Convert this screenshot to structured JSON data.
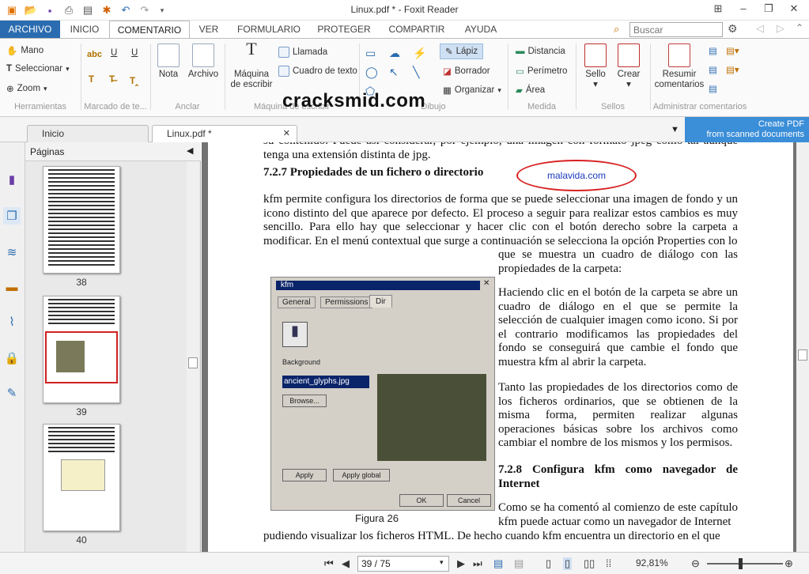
{
  "app": {
    "title": "Linux.pdf * - Foxit Reader"
  },
  "menu": {
    "tabs": [
      {
        "label": "ARCHIVO"
      },
      {
        "label": "INICIO"
      },
      {
        "label": "COMENTARIO"
      },
      {
        "label": "VER"
      },
      {
        "label": "FORMULARIO"
      },
      {
        "label": "PROTEGER"
      },
      {
        "label": "COMPARTIR"
      },
      {
        "label": "AYUDA"
      }
    ],
    "active": "COMENTARIO"
  },
  "search": {
    "placeholder": "Buscar"
  },
  "ribbon": {
    "tools": {
      "mano": "Mano",
      "seleccionar": "Seleccionar",
      "zoom": "Zoom"
    },
    "anclar": {
      "nota": "Nota",
      "archivo": "Archivo"
    },
    "maquina": {
      "label": "Máquina de escribir",
      "llamada": "Llamada",
      "cuadro": "Cuadro de texto"
    },
    "drawing": {
      "lapiz": "Lápiz",
      "borrador": "Borrador",
      "organizar": "Organizar"
    },
    "medida": {
      "distancia": "Distancia",
      "perimetro": "Perímetro",
      "area": "Área"
    },
    "sellos": {
      "sello": "Sello",
      "crear": "Crear"
    },
    "admin": {
      "resumir": "Resumir comentarios"
    },
    "groups": [
      "Herramientas",
      "Marcado de te...",
      "Anclar",
      "Máquina de escribir",
      "Dibujo",
      "Medida",
      "Sellos",
      "Administrar comentarios"
    ],
    "watermark": "cracksmid.com"
  },
  "doctabs": [
    {
      "label": "Inicio"
    },
    {
      "label": "Linux.pdf *"
    }
  ],
  "ad": {
    "line1": "Create PDF",
    "line2": "from scanned documents"
  },
  "panel": {
    "title": "Páginas",
    "pages": [
      "38",
      "39",
      "40"
    ]
  },
  "document": {
    "top": "su contenido. Puede así considerar, por ejemplo, una imagen con formato jpeg como tal aunque tenga una extensión distinta de jpg.",
    "heading1": "7.2.7  Propiedades de un fichero o directorio",
    "stamp": "malavida.com",
    "p1": "kfm permite configura los directorios de forma que se puede seleccionar una imagen de fondo y un icono distinto del que aparece por defecto. El proceso a seguir para realizar estos cambios es muy sencillo. Para ello hay que seleccionar y hacer clic con el botón derecho sobre la carpeta a modificar. En el menú contextual que surge a continuación se selecciona la opción Properties con lo",
    "p1b": "que se muestra un cuadro de diálogo con las propiedades de la carpeta:",
    "p2": "Haciendo clic en el botón de la carpeta se abre un cuadro de diálogo en el que se permite la selección de cualquier imagen como icono. Si por el contrario modificamos las propiedades del fondo se conseguirá que cambie el fondo que muestra kfm al abrir la carpeta.",
    "p3": "Tanto las propiedades de los directorios como de los ficheros ordinarios, que se obtienen de la misma forma, permiten realizar algunas operaciones básicas sobre los archivos como cambiar el nombre de los mismos y los permisos.",
    "heading2": "7.2.8  Configura kfm como navegador de Internet",
    "p4": "Como se ha comentó al comienzo de este capítulo kfm puede actuar como un navegador de Internet",
    "p5": "pudiendo visualizar los ficheros HTML. De hecho cuando kfm encuentra un directorio en el que",
    "caption": "Figura 26"
  },
  "dialog": {
    "title": "kfm",
    "tabs": [
      "General",
      "Permissions",
      "Dir"
    ],
    "background": "Background",
    "file": "ancient_glyphs.jpg",
    "browse": "Browse...",
    "apply": "Apply",
    "apply_global": "Apply global",
    "ok": "OK",
    "cancel": "Cancel"
  },
  "status": {
    "page": "39 / 75",
    "zoom": "92,81%"
  }
}
